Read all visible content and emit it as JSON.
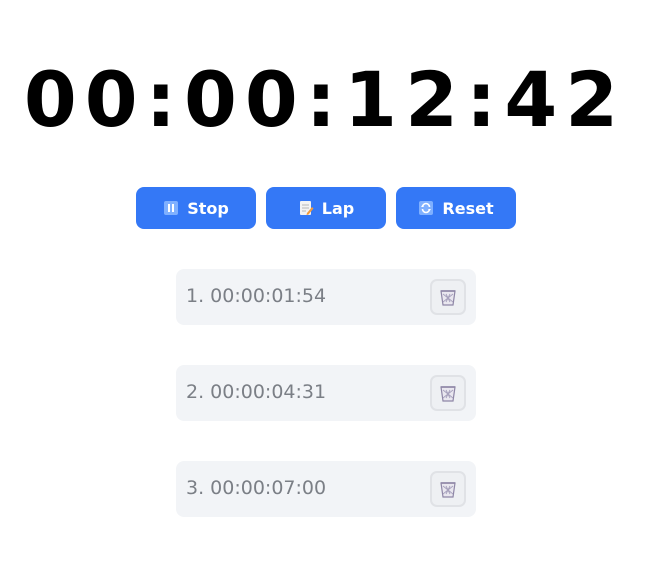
{
  "timer": {
    "display": "00:00:12:42"
  },
  "colors": {
    "accent": "#3478f6",
    "lap_bg": "#f2f4f7",
    "lap_text": "#7b7f86"
  },
  "controls": [
    {
      "label": "Stop",
      "icon": "pause-icon"
    },
    {
      "label": "Lap",
      "icon": "memo-icon"
    },
    {
      "label": "Reset",
      "icon": "refresh-icon"
    }
  ],
  "laps": [
    {
      "text": "1. 00:00:01:54",
      "icon": "trash-basket-icon"
    },
    {
      "text": "2. 00:00:04:31",
      "icon": "trash-basket-icon"
    },
    {
      "text": "3. 00:00:07:00",
      "icon": "trash-basket-icon"
    }
  ]
}
